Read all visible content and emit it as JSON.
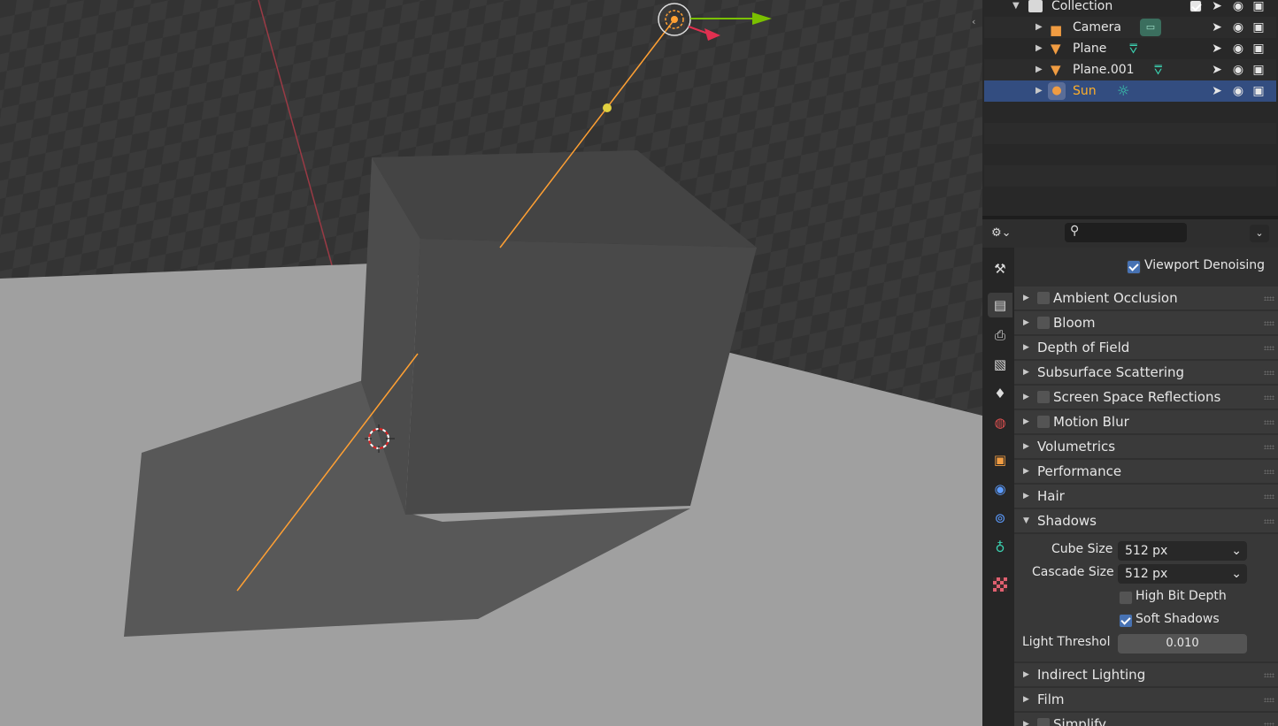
{
  "outliner": {
    "items": [
      {
        "name": "Collection"
      },
      {
        "name": "Camera"
      },
      {
        "name": "Plane"
      },
      {
        "name": "Plane.001"
      },
      {
        "name": "Sun"
      }
    ]
  },
  "properties": {
    "viewport_denoising": {
      "label": "Viewport Denoising",
      "checked": true
    },
    "panels": [
      {
        "label": "Ambient Occlusion",
        "checkbox": true,
        "checked": false
      },
      {
        "label": "Bloom",
        "checkbox": true,
        "checked": false
      },
      {
        "label": "Depth of Field"
      },
      {
        "label": "Subsurface Scattering"
      },
      {
        "label": "Screen Space Reflections",
        "checkbox": true,
        "checked": false
      },
      {
        "label": "Motion Blur",
        "checkbox": true,
        "checked": false
      },
      {
        "label": "Volumetrics"
      },
      {
        "label": "Performance"
      },
      {
        "label": "Hair"
      },
      {
        "label": "Shadows",
        "expanded": true
      },
      {
        "label": "Indirect Lighting"
      },
      {
        "label": "Film"
      },
      {
        "label": "Simplify",
        "checkbox": true,
        "checked": false
      }
    ],
    "shadows": {
      "cube_size_label": "Cube Size",
      "cube_size_value": "512 px",
      "cascade_size_label": "Cascade Size",
      "cascade_size_value": "512 px",
      "high_bit_depth": {
        "label": "High Bit Depth",
        "checked": false
      },
      "soft_shadows": {
        "label": "Soft Shadows",
        "checked": true
      },
      "light_threshold_label": "Light Threshol",
      "light_threshold_value": "0.010"
    }
  },
  "colors": {
    "selection": "#334d80",
    "selected_text": "#ffaf29",
    "accent_check": "#4772b3",
    "light_line": "#ffa033"
  }
}
